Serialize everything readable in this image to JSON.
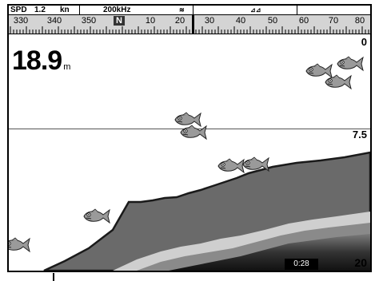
{
  "status": {
    "spd_label": "SPD",
    "spd_value": "1.2",
    "spd_unit": "kn",
    "frequency": "200kHz"
  },
  "compass": {
    "ticks": [
      "330",
      "340",
      "350",
      "N",
      "10",
      "20",
      "30",
      "40",
      "50",
      "60",
      "70",
      "80"
    ]
  },
  "sonar": {
    "depth_value": "18.9",
    "depth_unit": "m",
    "scale_top": "0",
    "scale_mid": "7.5",
    "scale_bottom": "20",
    "timer": "0:28"
  },
  "colors": {
    "bottom_fill": "#6a6a6a",
    "bottom_edge": "#1a1a1a",
    "compass_bg": "#d4d4d4"
  },
  "icons": [
    "fish-icon",
    "sonar-wave-icon",
    "battery-icon"
  ]
}
